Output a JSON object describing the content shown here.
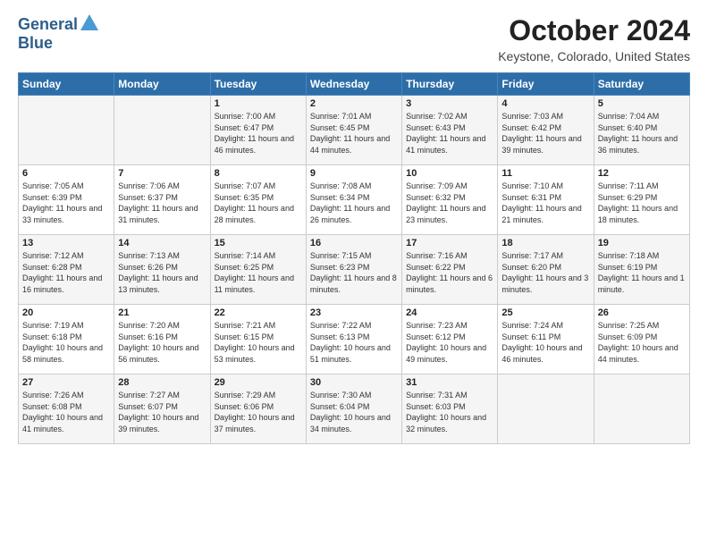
{
  "header": {
    "logo_line1": "General",
    "logo_line2": "Blue",
    "month": "October 2024",
    "location": "Keystone, Colorado, United States"
  },
  "weekdays": [
    "Sunday",
    "Monday",
    "Tuesday",
    "Wednesday",
    "Thursday",
    "Friday",
    "Saturday"
  ],
  "weeks": [
    [
      {
        "day": "",
        "info": ""
      },
      {
        "day": "",
        "info": ""
      },
      {
        "day": "1",
        "info": "Sunrise: 7:00 AM\nSunset: 6:47 PM\nDaylight: 11 hours\nand 46 minutes."
      },
      {
        "day": "2",
        "info": "Sunrise: 7:01 AM\nSunset: 6:45 PM\nDaylight: 11 hours\nand 44 minutes."
      },
      {
        "day": "3",
        "info": "Sunrise: 7:02 AM\nSunset: 6:43 PM\nDaylight: 11 hours\nand 41 minutes."
      },
      {
        "day": "4",
        "info": "Sunrise: 7:03 AM\nSunset: 6:42 PM\nDaylight: 11 hours\nand 39 minutes."
      },
      {
        "day": "5",
        "info": "Sunrise: 7:04 AM\nSunset: 6:40 PM\nDaylight: 11 hours\nand 36 minutes."
      }
    ],
    [
      {
        "day": "6",
        "info": "Sunrise: 7:05 AM\nSunset: 6:39 PM\nDaylight: 11 hours\nand 33 minutes."
      },
      {
        "day": "7",
        "info": "Sunrise: 7:06 AM\nSunset: 6:37 PM\nDaylight: 11 hours\nand 31 minutes."
      },
      {
        "day": "8",
        "info": "Sunrise: 7:07 AM\nSunset: 6:35 PM\nDaylight: 11 hours\nand 28 minutes."
      },
      {
        "day": "9",
        "info": "Sunrise: 7:08 AM\nSunset: 6:34 PM\nDaylight: 11 hours\nand 26 minutes."
      },
      {
        "day": "10",
        "info": "Sunrise: 7:09 AM\nSunset: 6:32 PM\nDaylight: 11 hours\nand 23 minutes."
      },
      {
        "day": "11",
        "info": "Sunrise: 7:10 AM\nSunset: 6:31 PM\nDaylight: 11 hours\nand 21 minutes."
      },
      {
        "day": "12",
        "info": "Sunrise: 7:11 AM\nSunset: 6:29 PM\nDaylight: 11 hours\nand 18 minutes."
      }
    ],
    [
      {
        "day": "13",
        "info": "Sunrise: 7:12 AM\nSunset: 6:28 PM\nDaylight: 11 hours\nand 16 minutes."
      },
      {
        "day": "14",
        "info": "Sunrise: 7:13 AM\nSunset: 6:26 PM\nDaylight: 11 hours\nand 13 minutes."
      },
      {
        "day": "15",
        "info": "Sunrise: 7:14 AM\nSunset: 6:25 PM\nDaylight: 11 hours\nand 11 minutes."
      },
      {
        "day": "16",
        "info": "Sunrise: 7:15 AM\nSunset: 6:23 PM\nDaylight: 11 hours\nand 8 minutes."
      },
      {
        "day": "17",
        "info": "Sunrise: 7:16 AM\nSunset: 6:22 PM\nDaylight: 11 hours\nand 6 minutes."
      },
      {
        "day": "18",
        "info": "Sunrise: 7:17 AM\nSunset: 6:20 PM\nDaylight: 11 hours\nand 3 minutes."
      },
      {
        "day": "19",
        "info": "Sunrise: 7:18 AM\nSunset: 6:19 PM\nDaylight: 11 hours\nand 1 minute."
      }
    ],
    [
      {
        "day": "20",
        "info": "Sunrise: 7:19 AM\nSunset: 6:18 PM\nDaylight: 10 hours\nand 58 minutes."
      },
      {
        "day": "21",
        "info": "Sunrise: 7:20 AM\nSunset: 6:16 PM\nDaylight: 10 hours\nand 56 minutes."
      },
      {
        "day": "22",
        "info": "Sunrise: 7:21 AM\nSunset: 6:15 PM\nDaylight: 10 hours\nand 53 minutes."
      },
      {
        "day": "23",
        "info": "Sunrise: 7:22 AM\nSunset: 6:13 PM\nDaylight: 10 hours\nand 51 minutes."
      },
      {
        "day": "24",
        "info": "Sunrise: 7:23 AM\nSunset: 6:12 PM\nDaylight: 10 hours\nand 49 minutes."
      },
      {
        "day": "25",
        "info": "Sunrise: 7:24 AM\nSunset: 6:11 PM\nDaylight: 10 hours\nand 46 minutes."
      },
      {
        "day": "26",
        "info": "Sunrise: 7:25 AM\nSunset: 6:09 PM\nDaylight: 10 hours\nand 44 minutes."
      }
    ],
    [
      {
        "day": "27",
        "info": "Sunrise: 7:26 AM\nSunset: 6:08 PM\nDaylight: 10 hours\nand 41 minutes."
      },
      {
        "day": "28",
        "info": "Sunrise: 7:27 AM\nSunset: 6:07 PM\nDaylight: 10 hours\nand 39 minutes."
      },
      {
        "day": "29",
        "info": "Sunrise: 7:29 AM\nSunset: 6:06 PM\nDaylight: 10 hours\nand 37 minutes."
      },
      {
        "day": "30",
        "info": "Sunrise: 7:30 AM\nSunset: 6:04 PM\nDaylight: 10 hours\nand 34 minutes."
      },
      {
        "day": "31",
        "info": "Sunrise: 7:31 AM\nSunset: 6:03 PM\nDaylight: 10 hours\nand 32 minutes."
      },
      {
        "day": "",
        "info": ""
      },
      {
        "day": "",
        "info": ""
      }
    ]
  ]
}
